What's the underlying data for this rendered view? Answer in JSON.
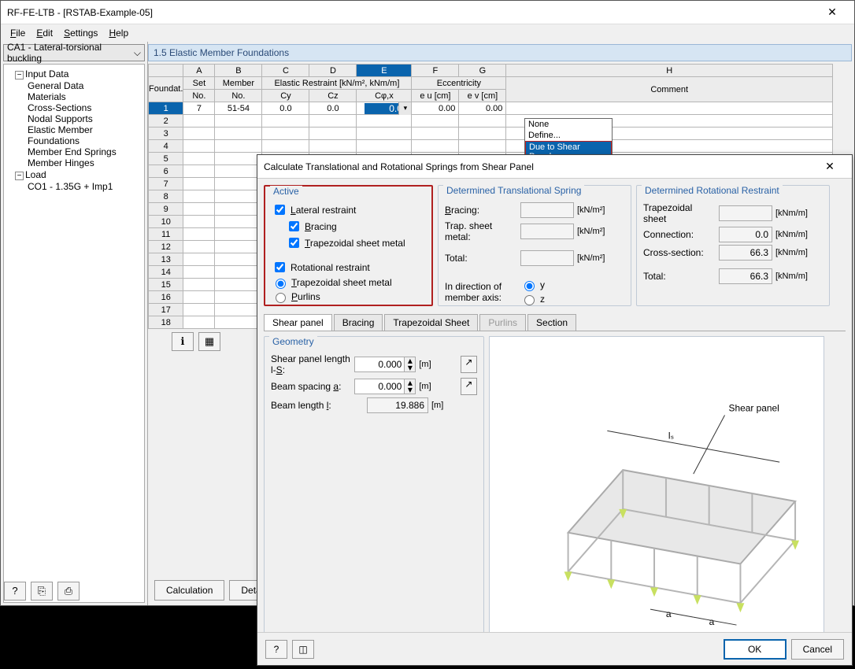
{
  "window": {
    "title": "RF-FE-LTB - [RSTAB-Example-05]",
    "close": "✕"
  },
  "menu": {
    "file": "File",
    "edit": "Edit",
    "settings": "Settings",
    "help": "Help"
  },
  "combo": {
    "text": "CA1 - Lateral-torsional buckling"
  },
  "tree": {
    "input": "Input Data",
    "items": {
      "general": "General Data",
      "materials": "Materials",
      "cross": "Cross-Sections",
      "nodal": "Nodal Supports",
      "elastic": "Elastic Member Foundations",
      "springs": "Member End Springs",
      "hinges": "Member Hinges"
    },
    "load": "Load",
    "loadchild": "CO1 - 1.35G + Imp1"
  },
  "panel": {
    "title": "1.5 Elastic Member Foundations"
  },
  "grid": {
    "cols": {
      "A": "A",
      "B": "B",
      "C": "C",
      "D": "D",
      "E": "E",
      "F": "F",
      "G": "G",
      "H": "H"
    },
    "h1": {
      "found": "Foundat.",
      "set": "Set",
      "member": "Member",
      "elastic": "Elastic Restraint  [kN/m², kNm/m]",
      "ecc": "Eccentricity",
      "comment": "Comment"
    },
    "h2": {
      "no": "No.",
      "cy": "Cy",
      "cz": "Cz",
      "cphi": "Cφ,x",
      "eu": "e u [cm]",
      "ev": "e v [cm]"
    },
    "row1": {
      "set": "7",
      "member": "51-54",
      "cy": "0.0",
      "cz": "0.0",
      "cphi": "0.0",
      "eu": "0.00",
      "ev": "0.00"
    },
    "rownums": [
      "1",
      "2",
      "3",
      "4",
      "5",
      "6",
      "7",
      "8",
      "9",
      "10",
      "11",
      "12",
      "13",
      "14",
      "15",
      "16",
      "17",
      "18"
    ]
  },
  "dropdown": {
    "none": "None",
    "define": "Define...",
    "shear": "Due to Shear Panel..."
  },
  "buttons": {
    "calc": "Calculation",
    "details": "Details...",
    "ok": "OK",
    "cancel": "Cancel"
  },
  "dialog": {
    "title": "Calculate Translational and Rotational Springs from Shear Panel",
    "active": {
      "legend": "Active",
      "lateral": "Lateral restraint",
      "bracing": "Bracing",
      "trap": "Trapezoidal sheet metal",
      "rot": "Rotational restraint",
      "rtrap": "Trapezoidal sheet metal",
      "purlins": "Purlins"
    },
    "trans": {
      "legend": "Determined Translational Spring",
      "bracing": "Bracing:",
      "trap": "Trap. sheet metal:",
      "total": "Total:",
      "dir": "In direction of member axis:",
      "y": "y",
      "z": "z",
      "unit": "[kN/m²]"
    },
    "rot": {
      "legend": "Determined Rotational Restraint",
      "trap": "Trapezoidal sheet",
      "conn": "Connection:",
      "cross": "Cross-section:",
      "total": "Total:",
      "v_conn": "0.0",
      "v_cross": "66.3",
      "v_total": "66.3",
      "unit": "[kNm/m]"
    },
    "tabs": {
      "shear": "Shear panel",
      "bracing": "Bracing",
      "trap": "Trapezoidal Sheet",
      "purlins": "Purlins",
      "section": "Section"
    },
    "geom": {
      "legend": "Geometry",
      "len": "Shear panel length l-S:",
      "spacing": "Beam spacing a:",
      "beam": "Beam length l:",
      "v_len": "0.000",
      "v_spacing": "0.000",
      "v_beam": "19.886",
      "m": "[m]"
    },
    "diag": {
      "shear": "Shear panel",
      "ls": "lₛ",
      "a": "a"
    }
  }
}
